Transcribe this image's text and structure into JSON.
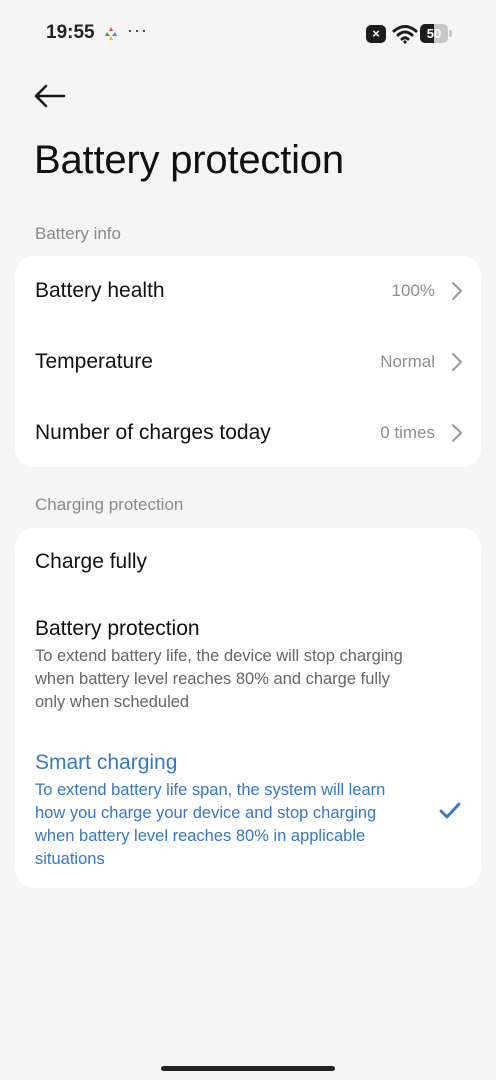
{
  "status_bar": {
    "time": "19:55",
    "more": "···",
    "notification_x": "×",
    "battery_level": "50",
    "battery_fraction": 0.5
  },
  "header": {
    "title": "Battery protection"
  },
  "battery_info": {
    "section_label": "Battery info",
    "rows": [
      {
        "label": "Battery health",
        "value": "100%"
      },
      {
        "label": "Temperature",
        "value": "Normal"
      },
      {
        "label": "Number of charges today",
        "value": "0 times"
      }
    ]
  },
  "charging_protection": {
    "section_label": "Charging protection",
    "options": [
      {
        "title": "Charge fully",
        "description": "",
        "selected": false
      },
      {
        "title": "Battery protection",
        "description": "To extend battery life, the device will stop charging when battery level reaches 80% and charge fully only when scheduled",
        "selected": false
      },
      {
        "title": "Smart charging",
        "description": "To extend battery life span, the system will learn how you charge your device and stop charging when battery level reaches 80% in applicable situations",
        "selected": true
      }
    ]
  },
  "colors": {
    "accent": "#3478c6",
    "background": "#f5f5f5",
    "card": "#ffffff",
    "secondary_text": "#8a8a8a"
  }
}
